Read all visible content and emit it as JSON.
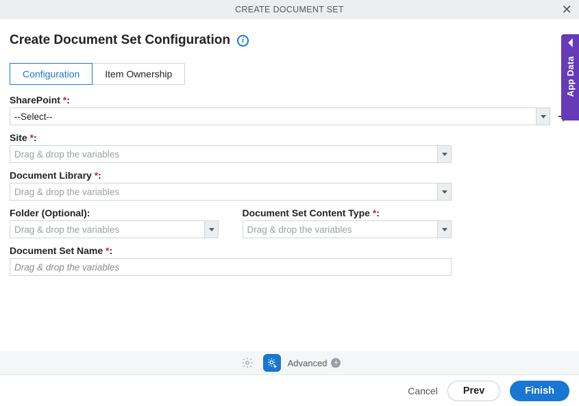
{
  "header": {
    "title": "CREATE DOCUMENT SET"
  },
  "page": {
    "heading": "Create Document Set Configuration"
  },
  "tabs": [
    {
      "label": "Configuration",
      "active": true
    },
    {
      "label": "Item Ownership",
      "active": false
    }
  ],
  "fields": {
    "sharepoint": {
      "label": "SharePoint",
      "required": true,
      "value": "--Select--"
    },
    "site": {
      "label": "Site",
      "required": true,
      "placeholder": "Drag & drop the variables"
    },
    "doclib": {
      "label": "Document Library",
      "required": true,
      "placeholder": "Drag & drop the variables"
    },
    "folder": {
      "label": "Folder (Optional):",
      "required": false,
      "placeholder": "Drag & drop the variables"
    },
    "contenttype": {
      "label": "Document Set Content Type",
      "required": true,
      "placeholder": "Drag & drop the variables"
    },
    "dsname": {
      "label": "Document Set Name",
      "required": true,
      "placeholder": "Drag & drop the variables"
    }
  },
  "footer_util": {
    "advanced": "Advanced"
  },
  "footer": {
    "cancel": "Cancel",
    "prev": "Prev",
    "finish": "Finish"
  },
  "drawer": {
    "label": "App Data"
  }
}
